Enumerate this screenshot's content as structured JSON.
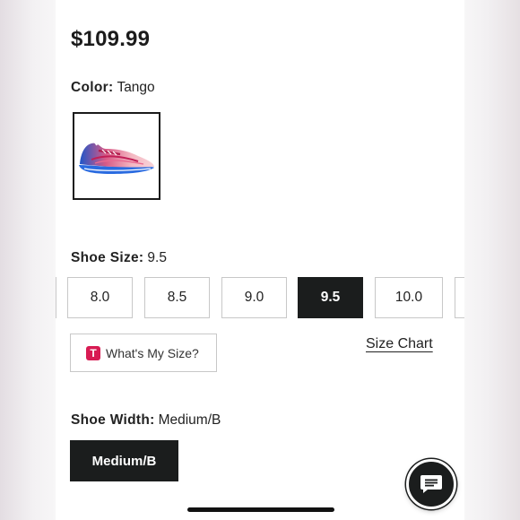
{
  "product": {
    "price": "$109.99",
    "color_label": "Color:",
    "color_value": "Tango",
    "swatch_icon": "shoe-image"
  },
  "size": {
    "label": "Shoe Size:",
    "value": "9.5",
    "options": [
      "8.0",
      "8.5",
      "9.0",
      "9.5",
      "10.0"
    ],
    "selected": "9.5",
    "whats_my_size": "What's My Size?",
    "whats_my_size_logo": "T",
    "size_chart": "Size Chart"
  },
  "width": {
    "label": "Shoe Width:",
    "value": "Medium/B",
    "option": "Medium/B"
  },
  "colors": {
    "accent_dark": "#1b1d1d",
    "logo_pink": "#d81b53"
  },
  "icons": {
    "chat": "chat-bubble-icon"
  }
}
